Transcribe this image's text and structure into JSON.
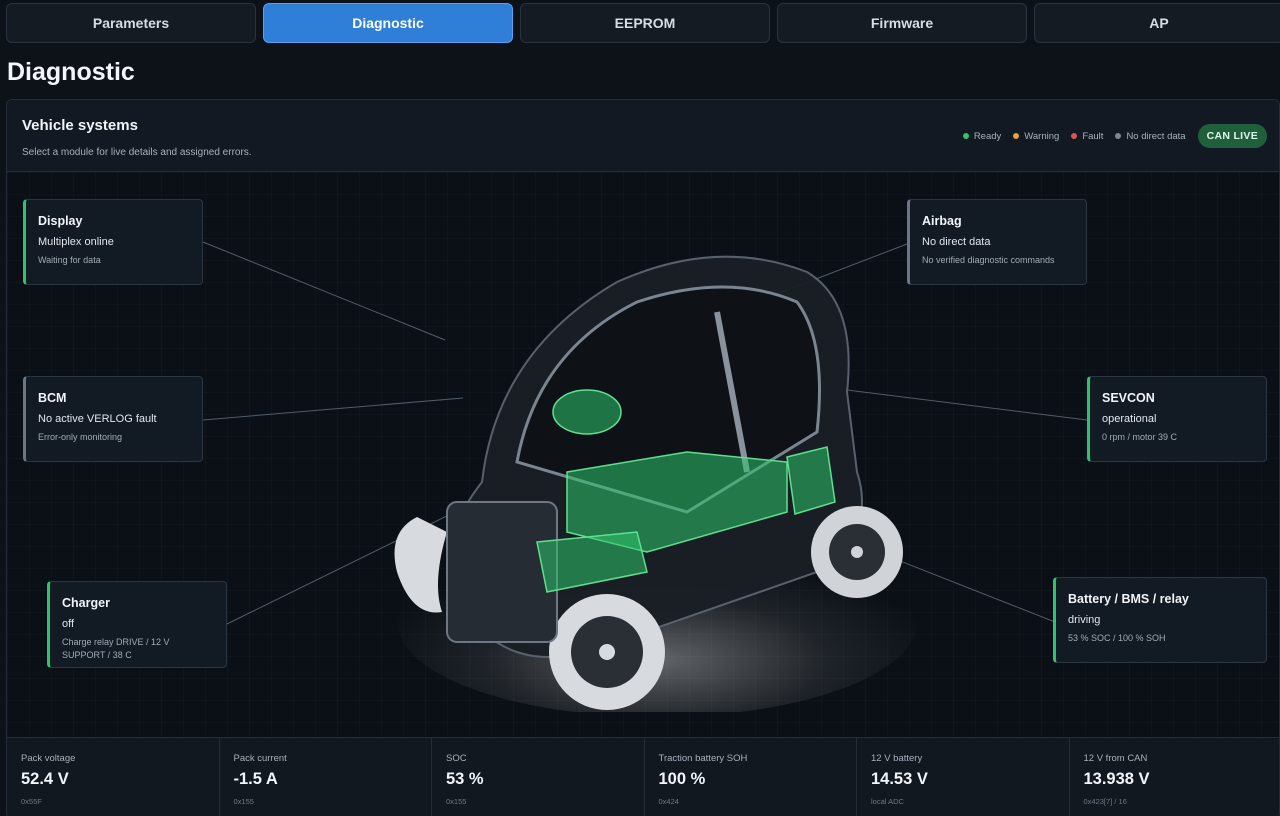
{
  "tabs": [
    {
      "label": "Parameters",
      "active": false
    },
    {
      "label": "Diagnostic",
      "active": true
    },
    {
      "label": "EEPROM",
      "active": false
    },
    {
      "label": "Firmware",
      "active": false
    },
    {
      "label": "AP",
      "active": false
    }
  ],
  "page_title": "Diagnostic",
  "panel": {
    "title": "Vehicle systems",
    "subtitle": "Select a module for live details and assigned errors.",
    "legend": [
      {
        "label": "Ready",
        "color": "#2ec46b"
      },
      {
        "label": "Warning",
        "color": "#e2a23a"
      },
      {
        "label": "Fault",
        "color": "#e05252"
      },
      {
        "label": "No direct data",
        "color": "#7c8793"
      }
    ],
    "can_badge": "CAN LIVE"
  },
  "modules": {
    "display": {
      "title": "Display",
      "status": "Multiplex online",
      "detail": "Waiting for data"
    },
    "airbag": {
      "title": "Airbag",
      "status": "No direct data",
      "detail": "No verified diagnostic commands"
    },
    "bcm": {
      "title": "BCM",
      "status": "No active VERLOG fault",
      "detail": "Error-only monitoring"
    },
    "sevcon": {
      "title": "SEVCON",
      "status": "operational",
      "detail": "0 rpm / motor 39 C"
    },
    "charger": {
      "title": "Charger",
      "status": "off",
      "detail": "Charge relay DRIVE / 12 V SUPPORT / 38 C"
    },
    "battery": {
      "title": "Battery / BMS / relay",
      "status": "driving",
      "detail": "53 % SOC / 100 % SOH"
    }
  },
  "metrics": [
    {
      "label": "Pack voltage",
      "value": "52.4 V",
      "source": "0x55F"
    },
    {
      "label": "Pack current",
      "value": "-1.5 A",
      "source": "0x155"
    },
    {
      "label": "SOC",
      "value": "53 %",
      "source": "0x155"
    },
    {
      "label": "Traction battery SOH",
      "value": "100 %",
      "source": "0x424"
    },
    {
      "label": "12 V battery",
      "value": "14.53 V",
      "source": "local ADC"
    },
    {
      "label": "12 V from CAN",
      "value": "13.938 V",
      "source": "0x423[7] / 16"
    }
  ]
}
